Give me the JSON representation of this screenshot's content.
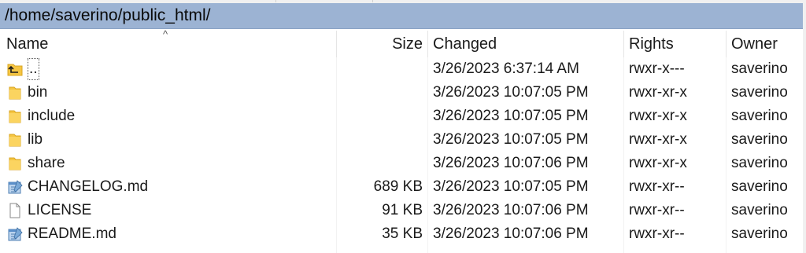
{
  "path": "/home/saverino/public_html/",
  "columns": {
    "name": "Name",
    "size": "Size",
    "changed": "Changed",
    "rights": "Rights",
    "owner": "Owner"
  },
  "sort_indicator": "^",
  "colors": {
    "path_bar": "#9cb3d3",
    "folder": "#f5c542"
  },
  "rows": [
    {
      "name": "..",
      "size": "",
      "changed": "3/26/2023 6:37:14 AM",
      "rights": "rwxr-x---",
      "owner": "saverino",
      "icon": "parent-folder-icon"
    },
    {
      "name": "bin",
      "size": "",
      "changed": "3/26/2023 10:07:05 PM",
      "rights": "rwxr-xr-x",
      "owner": "saverino",
      "icon": "folder-icon"
    },
    {
      "name": "include",
      "size": "",
      "changed": "3/26/2023 10:07:05 PM",
      "rights": "rwxr-xr-x",
      "owner": "saverino",
      "icon": "folder-icon"
    },
    {
      "name": "lib",
      "size": "",
      "changed": "3/26/2023 10:07:05 PM",
      "rights": "rwxr-xr-x",
      "owner": "saverino",
      "icon": "folder-icon"
    },
    {
      "name": "share",
      "size": "",
      "changed": "3/26/2023 10:07:06 PM",
      "rights": "rwxr-xr-x",
      "owner": "saverino",
      "icon": "folder-icon"
    },
    {
      "name": "CHANGELOG.md",
      "size": "689 KB",
      "changed": "3/26/2023 10:07:05 PM",
      "rights": "rwxr-xr--",
      "owner": "saverino",
      "icon": "notepad-file-icon"
    },
    {
      "name": "LICENSE",
      "size": "91 KB",
      "changed": "3/26/2023 10:07:06 PM",
      "rights": "rwxr-xr--",
      "owner": "saverino",
      "icon": "blank-file-icon"
    },
    {
      "name": "README.md",
      "size": "35 KB",
      "changed": "3/26/2023 10:07:06 PM",
      "rights": "rwxr-xr--",
      "owner": "saverino",
      "icon": "notepad-file-icon"
    }
  ]
}
